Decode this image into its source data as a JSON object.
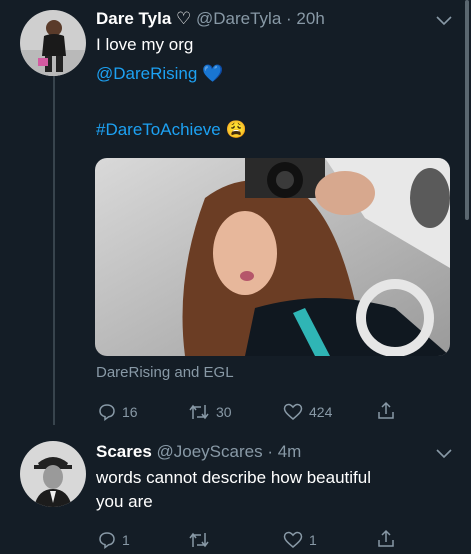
{
  "tweets": [
    {
      "name": "Dare Tyla",
      "name_suffix": "♡",
      "handle": "@DareTyla",
      "time": "20h",
      "lines": [
        "I love my org"
      ],
      "mention": "@DareRising",
      "mention_emoji": "💙",
      "hashtag": "#DareToAchieve",
      "hashtag_emoji": "😩",
      "media_caption": "DareRising and EGL",
      "actions": {
        "replies": "16",
        "retweets": "30",
        "likes": "424"
      }
    },
    {
      "name": "Scares",
      "handle": "@JoeyScares",
      "time": "4m",
      "lines": [
        "words cannot describe how beautiful",
        "you are"
      ],
      "actions": {
        "replies": "1",
        "retweets": "",
        "likes": "1"
      }
    }
  ],
  "colors": {
    "background": "#141d26",
    "accent": "#1da1f2",
    "muted": "#8899a6"
  },
  "icons": [
    "reply-icon",
    "retweet-icon",
    "like-icon",
    "share-icon",
    "chevron-down-icon"
  ]
}
